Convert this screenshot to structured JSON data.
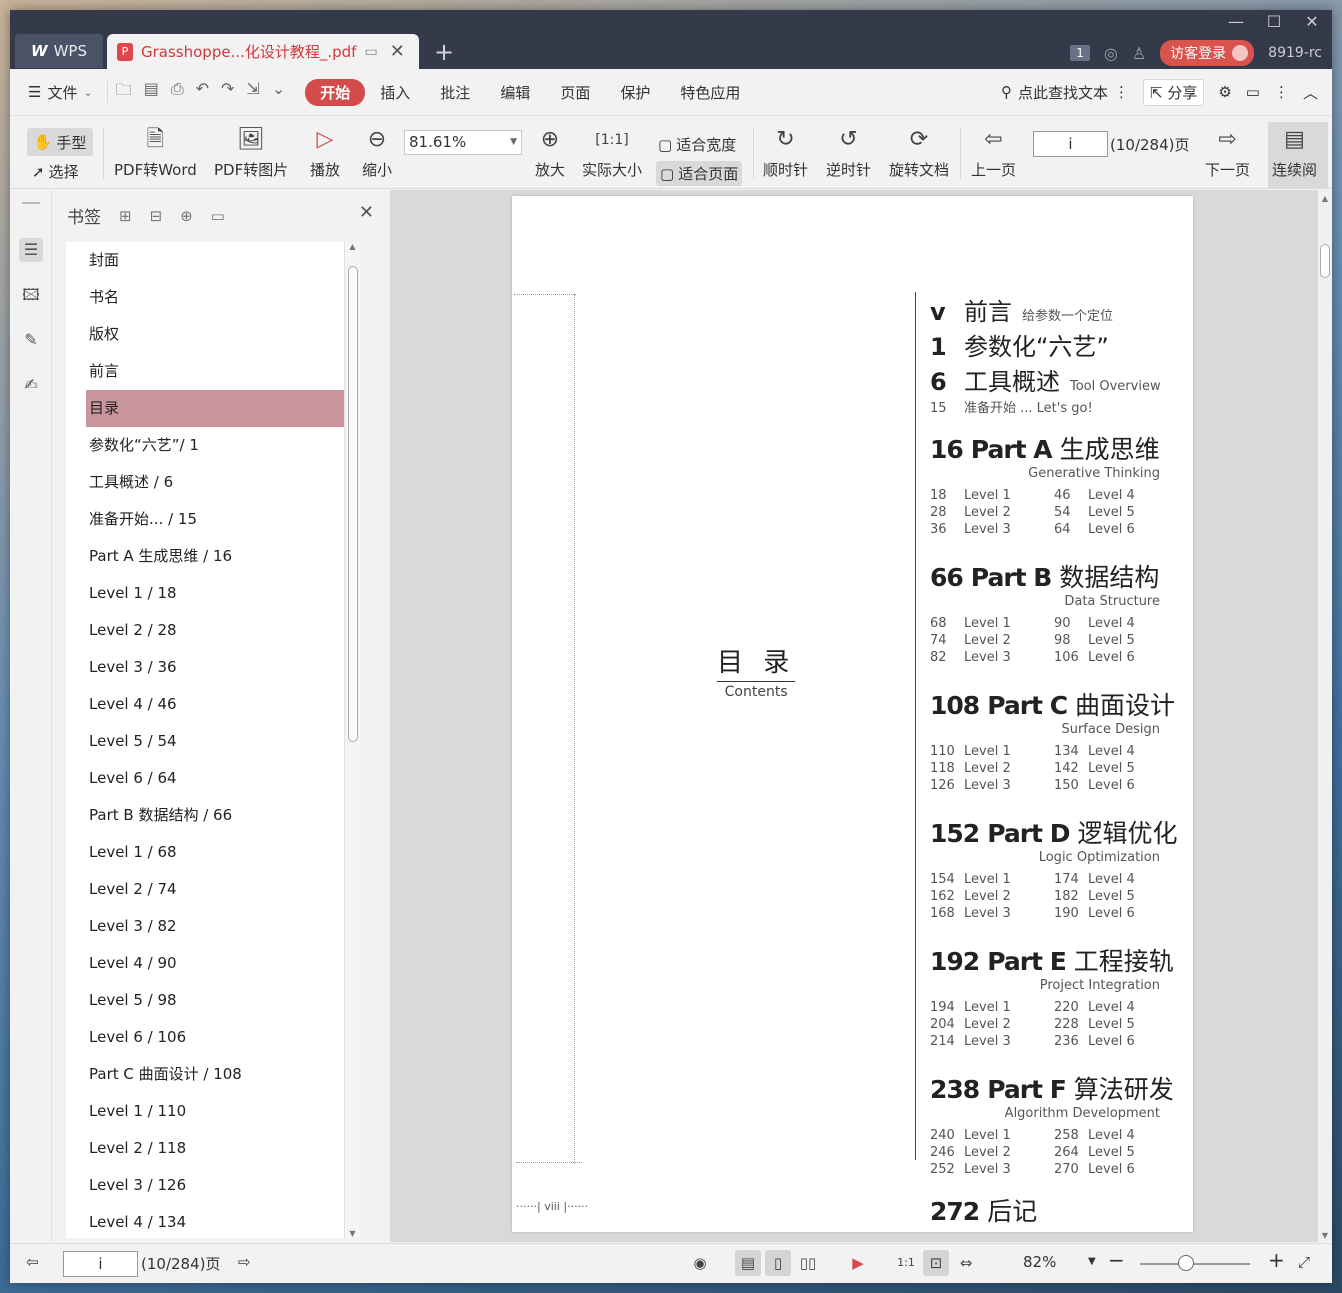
{
  "titlebar": {
    "app_tab": "WPS",
    "doc_tab": "Grasshoppe...化设计教程_.pdf",
    "badge": "1",
    "login": "访客登录",
    "user_id": "8919-rc"
  },
  "menubar": {
    "file": "文件",
    "tabs": [
      "开始",
      "插入",
      "批注",
      "编辑",
      "页面",
      "保护",
      "特色应用"
    ],
    "search": "点此查找文本",
    "share": "分享"
  },
  "toolbar": {
    "hand": "手型",
    "select": "选择",
    "pdf_word": "PDF转Word",
    "pdf_img": "PDF转图片",
    "play": "播放",
    "zoom_out": "缩小",
    "zoom_value": "81.61%",
    "zoom_in": "放大",
    "actual": "实际大小",
    "fit_width": "适合宽度",
    "fit_page": "适合页面",
    "cw": "顺时针",
    "ccw": "逆时针",
    "rotate": "旋转文档",
    "prev": "上一页",
    "page": "i",
    "page_total": "(10/284)页",
    "next": "下一页",
    "continuous": "连续阅"
  },
  "sidebar": {
    "title": "书签",
    "items": [
      "封面",
      "书名",
      "版权",
      "前言",
      "目录",
      "参数化“六艺”/ 1",
      "工具概述 / 6",
      "准备开始... / 15",
      "Part A  生成思维 / 16",
      "Level 1 / 18",
      "Level 2 / 28",
      "Level 3 / 36",
      "Level 4 / 46",
      "Level 5 / 54",
      "Level 6 / 64",
      "Part B  数据结构 / 66",
      "Level 1 / 68",
      "Level 2 / 74",
      "Level 3 / 82",
      "Level 4 / 90",
      "Level 5 / 98",
      "Level 6 / 106",
      "Part C  曲面设计 / 108",
      "Level 1 / 110",
      "Level 2 / 118",
      "Level 3 / 126",
      "Level 4 / 134"
    ],
    "selected_index": 4
  },
  "page": {
    "title_zh": "目 录",
    "title_en": "Contents",
    "intro": [
      {
        "n": "v",
        "t": "前言",
        "s": "给参数一个定位"
      },
      {
        "n": "1",
        "t": "参数化“六艺”",
        "s": ""
      },
      {
        "n": "6",
        "t": "工具概述",
        "s": "Tool Overview"
      },
      {
        "n": "15",
        "t": "",
        "s": "准备开始 ... Let's go!"
      }
    ],
    "parts": [
      {
        "num": "16",
        "label": "Part A",
        "zh": "生成思维",
        "en": "Generative Thinking",
        "levels": [
          [
            "18",
            "Level 1",
            "46",
            "Level 4"
          ],
          [
            "28",
            "Level 2",
            "54",
            "Level 5"
          ],
          [
            "36",
            "Level 3",
            "64",
            "Level 6"
          ]
        ]
      },
      {
        "num": "66",
        "label": "Part B",
        "zh": "数据结构",
        "en": "Data Structure",
        "levels": [
          [
            "68",
            "Level 1",
            "90",
            "Level 4"
          ],
          [
            "74",
            "Level 2",
            "98",
            "Level 5"
          ],
          [
            "82",
            "Level 3",
            "106",
            "Level 6"
          ]
        ]
      },
      {
        "num": "108",
        "label": "Part C",
        "zh": "曲面设计",
        "en": "Surface Design",
        "levels": [
          [
            "110",
            "Level 1",
            "134",
            "Level 4"
          ],
          [
            "118",
            "Level 2",
            "142",
            "Level 5"
          ],
          [
            "126",
            "Level 3",
            "150",
            "Level 6"
          ]
        ]
      },
      {
        "num": "152",
        "label": "Part D",
        "zh": "逻辑优化",
        "en": "Logic Optimization",
        "levels": [
          [
            "154",
            "Level 1",
            "174",
            "Level 4"
          ],
          [
            "162",
            "Level 2",
            "182",
            "Level 5"
          ],
          [
            "168",
            "Level 3",
            "190",
            "Level 6"
          ]
        ]
      },
      {
        "num": "192",
        "label": "Part E",
        "zh": "工程接轨",
        "en": "Project Integration",
        "levels": [
          [
            "194",
            "Level 1",
            "220",
            "Level 4"
          ],
          [
            "204",
            "Level 2",
            "228",
            "Level 5"
          ],
          [
            "214",
            "Level 3",
            "236",
            "Level 6"
          ]
        ]
      },
      {
        "num": "238",
        "label": "Part F",
        "zh": "算法研发",
        "en": "Algorithm Development",
        "levels": [
          [
            "240",
            "Level 1",
            "258",
            "Level 4"
          ],
          [
            "246",
            "Level 2",
            "264",
            "Level 5"
          ],
          [
            "252",
            "Level 3",
            "270",
            "Level 6"
          ]
        ]
      }
    ],
    "afterword": {
      "num": "272",
      "zh": "后记"
    },
    "footer": "viii"
  },
  "statusbar": {
    "page": "i",
    "page_total": "(10/284)页",
    "zoom": "82%"
  }
}
